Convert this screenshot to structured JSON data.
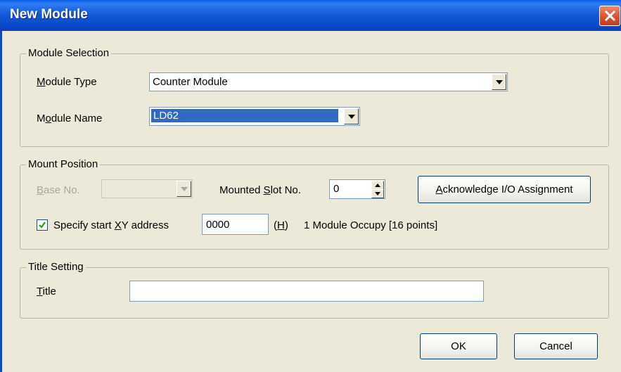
{
  "window": {
    "title": "New Module",
    "close_icon": "close-icon"
  },
  "module_selection": {
    "legend": "Module Selection",
    "module_type_label": "Module Type",
    "module_type_value": "Counter Module",
    "module_name_label": "Module Name",
    "module_name_value": "LD62"
  },
  "mount_position": {
    "legend": "Mount Position",
    "base_no_label": "Base No.",
    "base_no_value": "",
    "mounted_slot_label": "Mounted Slot No.",
    "mounted_slot_value": "0",
    "acknowledge_button": "Acknowledge I/O Assignment",
    "specify_start_label": "Specify start XY address",
    "specify_start_checked": true,
    "start_address_value": "0000",
    "hex_unit": "(H)",
    "occupy_text": "1 Module Occupy [16 points]"
  },
  "title_setting": {
    "legend": "Title Setting",
    "title_label": "Title",
    "title_value": ""
  },
  "footer": {
    "ok_label": "OK",
    "cancel_label": "Cancel"
  },
  "colors": {
    "titlebar": "#0A5EE5",
    "dialog_bg": "#ECE9D8",
    "selection": "#316AC5",
    "close": "#D8532C"
  }
}
